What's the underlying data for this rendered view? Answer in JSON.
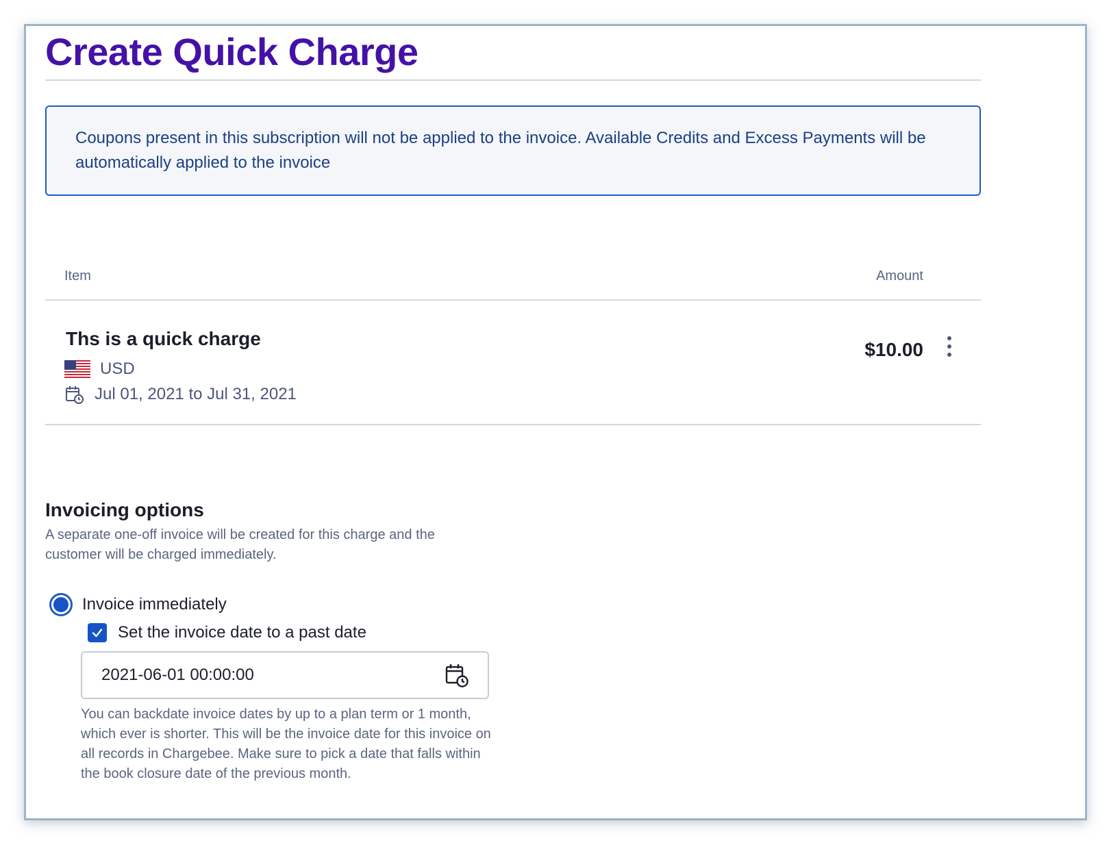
{
  "page": {
    "title": "Create Quick Charge"
  },
  "notice": {
    "text": "Coupons present in this subscription will not be applied to the invoice. Available Credits and Excess Payments will be automatically applied to the invoice"
  },
  "table": {
    "headers": {
      "item": "Item",
      "amount": "Amount"
    },
    "rows": [
      {
        "title": "Ths is a quick charge",
        "currency": "USD",
        "currency_icon": "us-flag-icon",
        "period": "Jul 01, 2021 to Jul 31, 2021",
        "period_icon": "calendar-clock-icon",
        "amount": "$10.00",
        "menu_icon": "more-vertical-icon"
      }
    ]
  },
  "invoicing": {
    "title": "Invoicing options",
    "description": "A separate one-off invoice will be created for this charge and the customer will be charged immediately.",
    "option_immediate": {
      "label": "Invoice immediately",
      "selected": true
    },
    "past_date": {
      "label": "Set the invoice date to a past date",
      "checked": true
    },
    "date_value": "2021-06-01 00:00:00",
    "date_icon": "calendar-clock-icon",
    "help": "You can backdate invoice dates by up to a plan term or 1 month, which ever is shorter. This will be the invoice date for this invoice on all records in Chargebee. Make sure to pick a date that falls within the book closure date of the previous month."
  },
  "colors": {
    "title": "#4412a6",
    "accent": "#1553c7",
    "notice_border": "#1f5bc4",
    "notice_text": "#1d3f82",
    "muted_text": "#5b6480"
  }
}
